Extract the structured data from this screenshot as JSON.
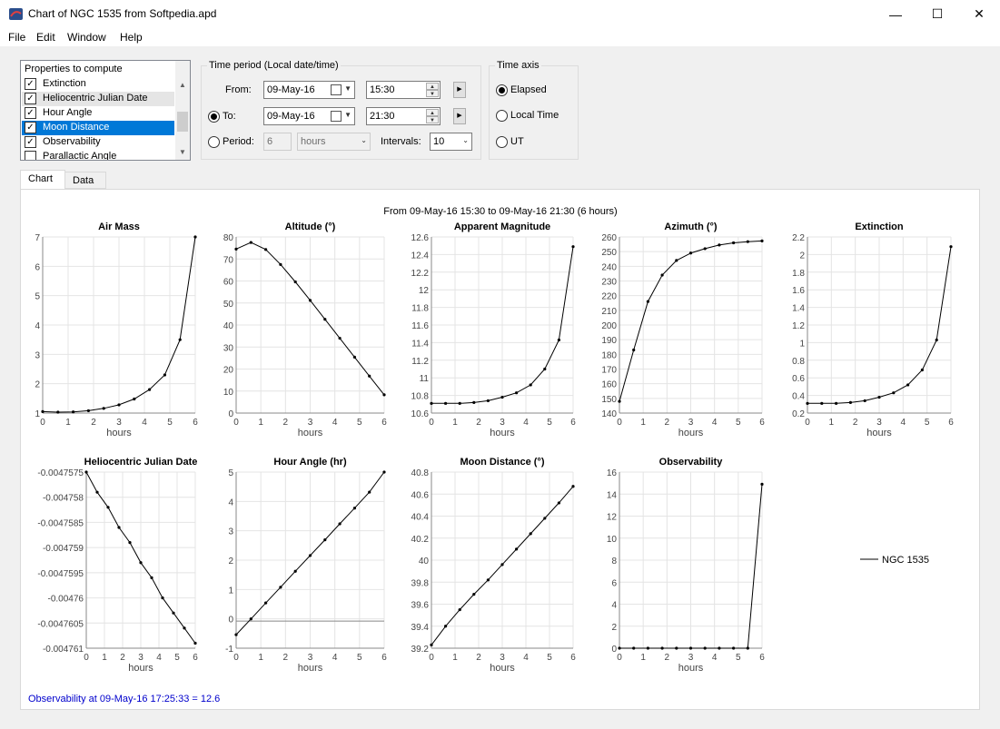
{
  "window": {
    "title": "Chart of NGC 1535 from Softpedia.apd",
    "minimize": "—",
    "maximize": "☐",
    "close": "✕"
  },
  "menu": [
    "File",
    "Edit",
    "Window",
    "Help"
  ],
  "properties": {
    "header": "Properties to compute",
    "items": [
      {
        "label": "Extinction",
        "checked": true
      },
      {
        "label": "Heliocentric Julian Date",
        "checked": true
      },
      {
        "label": "Hour Angle",
        "checked": true
      },
      {
        "label": "Moon Distance",
        "checked": true
      },
      {
        "label": "Observability",
        "checked": true
      },
      {
        "label": "Parallactic Angle",
        "checked": false
      }
    ]
  },
  "time_period": {
    "title": "Time period  (Local date/time)",
    "from_label": "From:",
    "from_date": "09-May-16",
    "from_time": "15:30",
    "to_label": "To:",
    "to_date": "09-May-16",
    "to_time": "21:30",
    "period_label": "Period:",
    "period_value": "6",
    "period_unit": "hours",
    "intervals_label": "Intervals:",
    "intervals_value": "10"
  },
  "time_axis": {
    "title": "Time axis",
    "options": [
      "Elapsed",
      "Local Time",
      "UT"
    ],
    "selected": "Elapsed"
  },
  "tabs": [
    "Chart",
    "Data"
  ],
  "chart_header": "From 09-May-16 15:30  to  09-May-16 21:30  (6 hours)",
  "legend": {
    "label": "NGC 1535",
    "color": "#000000"
  },
  "status": "Observability at 09-May-16 17:25:33 = 12.6",
  "chart_data": [
    {
      "type": "line",
      "title": "Air Mass",
      "xlabel": "hours",
      "xlim": [
        0,
        6
      ],
      "ylim": [
        1,
        7
      ],
      "yticks": [
        "1",
        "2",
        "3",
        "4",
        "5",
        "6",
        "7"
      ],
      "x": [
        0,
        0.6,
        1.2,
        1.8,
        2.4,
        3.0,
        3.6,
        4.2,
        4.8,
        5.4,
        6.0
      ],
      "series": [
        {
          "values": [
            1.05,
            1.03,
            1.04,
            1.08,
            1.16,
            1.28,
            1.48,
            1.8,
            2.3,
            3.5,
            7.0
          ]
        }
      ]
    },
    {
      "type": "line",
      "title": "Altitude (°)",
      "xlabel": "hours",
      "xlim": [
        0,
        6
      ],
      "ylim": [
        0,
        80
      ],
      "yticks": [
        "0",
        "10",
        "20",
        "30",
        "40",
        "50",
        "60",
        "70",
        "80"
      ],
      "x": [
        0,
        0.6,
        1.2,
        1.8,
        2.4,
        3.0,
        3.6,
        4.2,
        4.8,
        5.4,
        6.0
      ],
      "series": [
        {
          "values": [
            74.5,
            77.5,
            74.3,
            67.5,
            59.6,
            51.2,
            42.6,
            34.0,
            25.4,
            16.8,
            8.3
          ]
        }
      ]
    },
    {
      "type": "line",
      "title": "Apparent Magnitude",
      "xlabel": "hours",
      "xlim": [
        0,
        6
      ],
      "ylim": [
        10.6,
        12.6
      ],
      "yticks": [
        "10.6",
        "10.8",
        "11",
        "11.2",
        "11.4",
        "11.6",
        "11.8",
        "12",
        "12.2",
        "12.4",
        "12.6"
      ],
      "x": [
        0,
        0.6,
        1.2,
        1.8,
        2.4,
        3.0,
        3.6,
        4.2,
        4.8,
        5.4,
        6.0
      ],
      "series": [
        {
          "values": [
            10.71,
            10.71,
            10.71,
            10.72,
            10.74,
            10.78,
            10.83,
            10.92,
            11.1,
            11.43,
            12.49
          ]
        }
      ]
    },
    {
      "type": "line",
      "title": "Azimuth (°)",
      "xlabel": "hours",
      "xlim": [
        0,
        6
      ],
      "ylim": [
        140,
        260
      ],
      "yticks": [
        "140",
        "150",
        "160",
        "170",
        "180",
        "190",
        "200",
        "210",
        "220",
        "230",
        "240",
        "250",
        "260"
      ],
      "x": [
        0,
        0.6,
        1.2,
        1.8,
        2.4,
        3.0,
        3.6,
        4.2,
        4.8,
        5.4,
        6.0
      ],
      "series": [
        {
          "values": [
            148,
            183,
            216,
            234,
            244,
            249,
            252,
            254.5,
            256,
            256.8,
            257.3
          ]
        }
      ]
    },
    {
      "type": "line",
      "title": "Extinction",
      "xlabel": "hours",
      "xlim": [
        0,
        6
      ],
      "ylim": [
        0.2,
        2.2
      ],
      "yticks": [
        "0.2",
        "0.4",
        "0.6",
        "0.8",
        "1",
        "1.2",
        "1.4",
        "1.6",
        "1.8",
        "2",
        "2.2"
      ],
      "x": [
        0,
        0.6,
        1.2,
        1.8,
        2.4,
        3.0,
        3.6,
        4.2,
        4.8,
        5.4,
        6.0
      ],
      "series": [
        {
          "values": [
            0.31,
            0.31,
            0.31,
            0.32,
            0.34,
            0.38,
            0.43,
            0.52,
            0.69,
            1.03,
            2.09
          ]
        }
      ]
    },
    {
      "type": "line",
      "title": "Heliocentric Julian Date",
      "xlabel": "hours",
      "xlim": [
        0,
        6
      ],
      "ylim": [
        -0.004761,
        -0.0047575
      ],
      "yticks": [
        "-0.004761",
        "-0.0047605",
        "-0.00476",
        "-0.0047595",
        "-0.004759",
        "-0.0047585",
        "-0.004758",
        "-0.0047575"
      ],
      "x": [
        0,
        0.6,
        1.2,
        1.8,
        2.4,
        3.0,
        3.6,
        4.2,
        4.8,
        5.4,
        6.0
      ],
      "series": [
        {
          "values": [
            -0.0047575,
            -0.0047579,
            -0.0047582,
            -0.0047586,
            -0.0047589,
            -0.0047593,
            -0.0047596,
            -0.00476,
            -0.0047603,
            -0.0047606,
            -0.0047609
          ]
        }
      ]
    },
    {
      "type": "line",
      "title": "Hour Angle (hr)",
      "xlabel": "hours",
      "xlim": [
        0,
        6
      ],
      "ylim": [
        -1,
        5.5
      ],
      "yticks": [
        "-1",
        "0",
        "1",
        "2",
        "3",
        "4",
        "5"
      ],
      "x": [
        0,
        0.6,
        1.2,
        1.8,
        2.4,
        3.0,
        3.6,
        4.2,
        4.8,
        5.4,
        6.0
      ],
      "series": [
        {
          "values": [
            -0.5,
            0.08,
            0.67,
            1.25,
            1.84,
            2.42,
            3.0,
            3.59,
            4.17,
            4.76,
            5.5
          ]
        }
      ]
    },
    {
      "type": "line",
      "title": "Moon Distance (°)",
      "xlabel": "hours",
      "xlim": [
        0,
        6
      ],
      "ylim": [
        39.2,
        40.8
      ],
      "yticks": [
        "39.2",
        "39.4",
        "39.6",
        "39.8",
        "40",
        "40.2",
        "40.4",
        "40.6",
        "40.8"
      ],
      "x": [
        0,
        0.6,
        1.2,
        1.8,
        2.4,
        3.0,
        3.6,
        4.2,
        4.8,
        5.4,
        6.0
      ],
      "series": [
        {
          "values": [
            39.23,
            39.4,
            39.55,
            39.69,
            39.82,
            39.96,
            40.1,
            40.24,
            40.38,
            40.52,
            40.67
          ]
        }
      ]
    },
    {
      "type": "line",
      "title": "Observability",
      "xlabel": "hours",
      "xlim": [
        0,
        6
      ],
      "ylim": [
        0,
        16
      ],
      "yticks": [
        "0",
        "2",
        "4",
        "6",
        "8",
        "10",
        "12",
        "14",
        "16"
      ],
      "x": [
        0,
        0.6,
        1.2,
        1.8,
        2.4,
        3.0,
        3.6,
        4.2,
        4.8,
        5.4,
        6.0
      ],
      "series": [
        {
          "values": [
            0,
            0,
            0,
            0,
            0,
            0,
            0,
            0,
            0,
            0,
            14.9
          ]
        }
      ]
    }
  ]
}
